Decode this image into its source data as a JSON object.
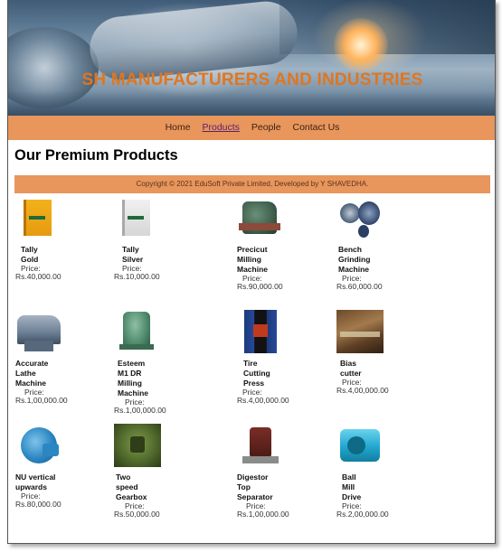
{
  "header": {
    "title": "SH MANUFACTURERS AND INDUSTRIES"
  },
  "nav": {
    "items": [
      {
        "label": "Home"
      },
      {
        "label": "Products"
      },
      {
        "label": "People"
      },
      {
        "label": "Contact Us"
      }
    ],
    "active": "Products"
  },
  "main": {
    "title": "Our Premium Products",
    "copyright": "Copyright © 2021 EduSoft Private Limited, Developed by Y SHAVEDHA."
  },
  "price_label": "Price:",
  "products": [
    {
      "name": "Tally Gold",
      "price": "Rs.40,000.00",
      "icon": "software-box-gold"
    },
    {
      "name": "Tally Silver",
      "price": "Rs.10,000.00",
      "icon": "software-box-silver"
    },
    {
      "name": "Precicut Milling Machine",
      "price": "Rs.90,000.00",
      "icon": "milling-machine"
    },
    {
      "name": "Bench Grinding Machine",
      "price": "Rs.60,000.00",
      "icon": "bench-grinder"
    },
    {
      "name": "Accurate Lathe Machine",
      "price": "Rs.1,00,000.00",
      "icon": "lathe-machine"
    },
    {
      "name": "Esteem M1 DR Milling Machine",
      "price": "Rs.1,00,000.00",
      "icon": "milling-machine"
    },
    {
      "name": "Tire Cutting Press",
      "price": "Rs.4,00,000.00",
      "icon": "cutting-press"
    },
    {
      "name": "Bias cutter",
      "price": "Rs.4,00,000.00",
      "icon": "bias-cutter"
    },
    {
      "name": "NU vertical upwards",
      "price": "Rs.80,000.00",
      "icon": "gear-motor"
    },
    {
      "name": "Two speed Gearbox",
      "price": "Rs.50,000.00",
      "icon": "gearbox"
    },
    {
      "name": "Digestor Top Separator",
      "price": "Rs.1,00,000.00",
      "icon": "separator"
    },
    {
      "name": "Ball Mill Drive",
      "price": "Rs.2,00,000.00",
      "icon": "ball-mill-drive"
    }
  ],
  "colors": {
    "brand_text": "#e0761f",
    "nav_bg": "#e8965c",
    "active_link": "#5b1f6e"
  }
}
